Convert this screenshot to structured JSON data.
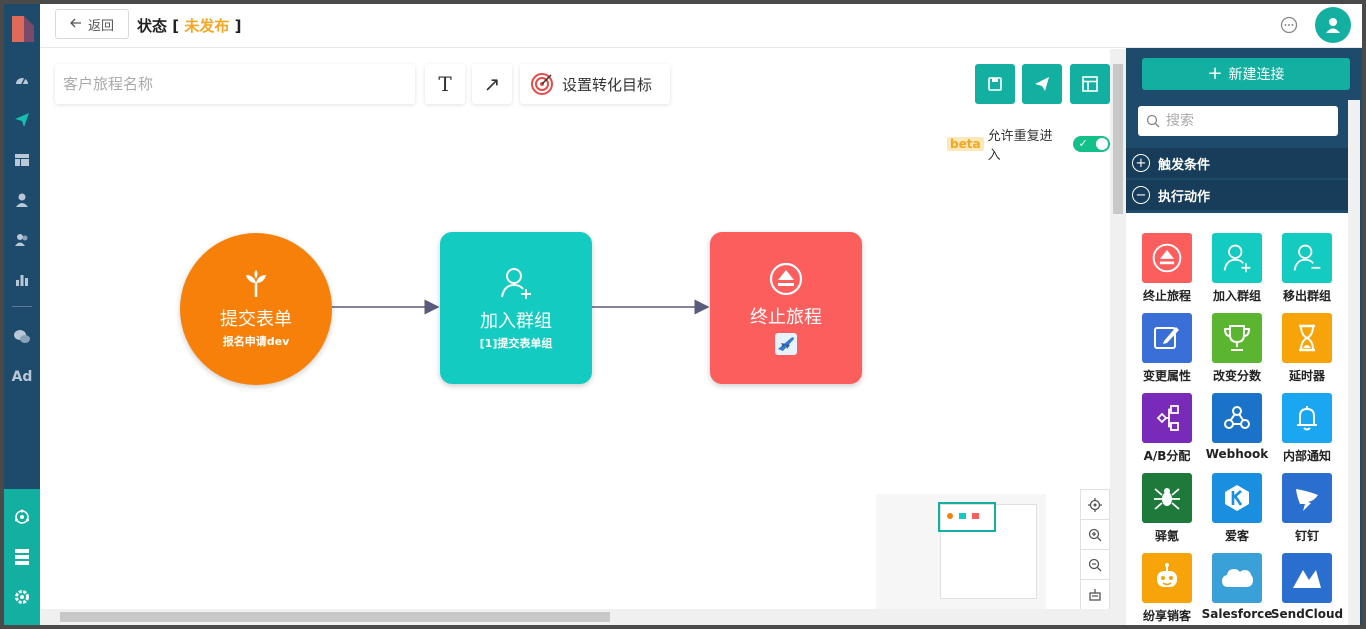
{
  "header": {
    "back_label": "返回",
    "status_prefix": "状态",
    "status_open": "[",
    "status_value": "未发布",
    "status_close": "]"
  },
  "toolbar": {
    "name_placeholder": "客户旅程名称",
    "text_tool_glyph": "T",
    "arrow_tool_glyph": "↗",
    "goal_label": "设置转化目标",
    "beta_label": "beta",
    "reentry_label": "允许重复进入",
    "reentry_enabled": true
  },
  "flow": {
    "nodes": [
      {
        "id": "trigger",
        "title": "提交表单",
        "subtitle": "报名申请dev",
        "color": "#f7800a",
        "icon": "sprout-icon"
      },
      {
        "id": "join",
        "title": "加入群组",
        "subtitle": "[1]提交表单组",
        "color": "#13cbc0",
        "icon": "add-user-icon"
      },
      {
        "id": "stop",
        "title": "终止旅程",
        "subtitle": "",
        "color": "#fc5d5d",
        "icon": "eject-icon"
      }
    ]
  },
  "panel": {
    "new_connection_label": "新建连接",
    "search_placeholder": "搜索",
    "sections": [
      {
        "label": "触发条件",
        "state": "collapsed"
      },
      {
        "label": "执行动作",
        "state": "expanded"
      }
    ],
    "actions": [
      {
        "label": "终止旅程",
        "color": "#fc5d5d",
        "icon": "eject-icon"
      },
      {
        "label": "加入群组",
        "color": "#13cbc0",
        "icon": "add-user-icon"
      },
      {
        "label": "移出群组",
        "color": "#13cbc0",
        "icon": "remove-user-icon"
      },
      {
        "label": "变更属性",
        "color": "#3a6fd8",
        "icon": "edit-icon"
      },
      {
        "label": "改变分数",
        "color": "#5cb531",
        "icon": "trophy-icon"
      },
      {
        "label": "延时器",
        "color": "#f7a30a",
        "icon": "hourglass-icon"
      },
      {
        "label": "A/B分配",
        "color": "#7a2ab8",
        "icon": "split-icon"
      },
      {
        "label": "Webhook",
        "color": "#1a73c8",
        "icon": "webhook-icon"
      },
      {
        "label": "内部通知",
        "color": "#1aa6f0",
        "icon": "bell-icon"
      },
      {
        "label": "驿氪",
        "color": "#1e7a3a",
        "icon": "spider-icon"
      },
      {
        "label": "爱客",
        "color": "#1a8fe0",
        "icon": "k-logo-icon"
      },
      {
        "label": "钉钉",
        "color": "#2a6fd0",
        "icon": "dingtalk-icon"
      },
      {
        "label": "纷享销客",
        "color": "#f7a30a",
        "icon": "robot-icon"
      },
      {
        "label": "Salesforce",
        "color": "#3aa0d8",
        "icon": "cloud-icon"
      },
      {
        "label": "SendCloud",
        "color": "#2a6fd0",
        "icon": "sendcloud-icon"
      }
    ]
  },
  "colors": {
    "nav_bg": "#1e4a6b",
    "accent": "#13b0a2",
    "status_value": "#f5a623"
  }
}
